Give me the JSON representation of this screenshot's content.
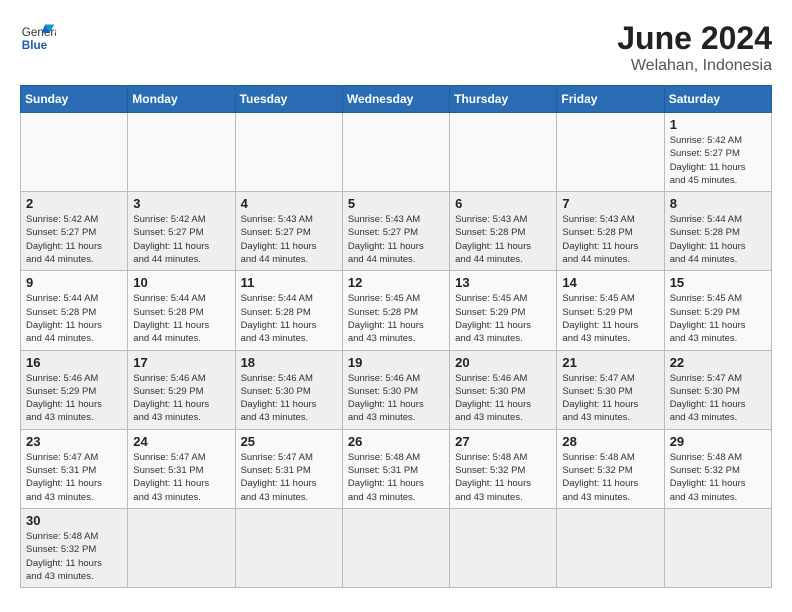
{
  "header": {
    "logo_general": "General",
    "logo_blue": "Blue",
    "month_title": "June 2024",
    "subtitle": "Welahan, Indonesia"
  },
  "days_of_week": [
    "Sunday",
    "Monday",
    "Tuesday",
    "Wednesday",
    "Thursday",
    "Friday",
    "Saturday"
  ],
  "weeks": [
    [
      {
        "day": "",
        "info": ""
      },
      {
        "day": "",
        "info": ""
      },
      {
        "day": "",
        "info": ""
      },
      {
        "day": "",
        "info": ""
      },
      {
        "day": "",
        "info": ""
      },
      {
        "day": "",
        "info": ""
      },
      {
        "day": "1",
        "info": "Sunrise: 5:42 AM\nSunset: 5:27 PM\nDaylight: 11 hours\nand 45 minutes."
      }
    ],
    [
      {
        "day": "2",
        "info": "Sunrise: 5:42 AM\nSunset: 5:27 PM\nDaylight: 11 hours\nand 44 minutes."
      },
      {
        "day": "3",
        "info": "Sunrise: 5:42 AM\nSunset: 5:27 PM\nDaylight: 11 hours\nand 44 minutes."
      },
      {
        "day": "4",
        "info": "Sunrise: 5:43 AM\nSunset: 5:27 PM\nDaylight: 11 hours\nand 44 minutes."
      },
      {
        "day": "5",
        "info": "Sunrise: 5:43 AM\nSunset: 5:27 PM\nDaylight: 11 hours\nand 44 minutes."
      },
      {
        "day": "6",
        "info": "Sunrise: 5:43 AM\nSunset: 5:28 PM\nDaylight: 11 hours\nand 44 minutes."
      },
      {
        "day": "7",
        "info": "Sunrise: 5:43 AM\nSunset: 5:28 PM\nDaylight: 11 hours\nand 44 minutes."
      },
      {
        "day": "8",
        "info": "Sunrise: 5:44 AM\nSunset: 5:28 PM\nDaylight: 11 hours\nand 44 minutes."
      }
    ],
    [
      {
        "day": "9",
        "info": "Sunrise: 5:44 AM\nSunset: 5:28 PM\nDaylight: 11 hours\nand 44 minutes."
      },
      {
        "day": "10",
        "info": "Sunrise: 5:44 AM\nSunset: 5:28 PM\nDaylight: 11 hours\nand 44 minutes."
      },
      {
        "day": "11",
        "info": "Sunrise: 5:44 AM\nSunset: 5:28 PM\nDaylight: 11 hours\nand 43 minutes."
      },
      {
        "day": "12",
        "info": "Sunrise: 5:45 AM\nSunset: 5:28 PM\nDaylight: 11 hours\nand 43 minutes."
      },
      {
        "day": "13",
        "info": "Sunrise: 5:45 AM\nSunset: 5:29 PM\nDaylight: 11 hours\nand 43 minutes."
      },
      {
        "day": "14",
        "info": "Sunrise: 5:45 AM\nSunset: 5:29 PM\nDaylight: 11 hours\nand 43 minutes."
      },
      {
        "day": "15",
        "info": "Sunrise: 5:45 AM\nSunset: 5:29 PM\nDaylight: 11 hours\nand 43 minutes."
      }
    ],
    [
      {
        "day": "16",
        "info": "Sunrise: 5:46 AM\nSunset: 5:29 PM\nDaylight: 11 hours\nand 43 minutes."
      },
      {
        "day": "17",
        "info": "Sunrise: 5:46 AM\nSunset: 5:29 PM\nDaylight: 11 hours\nand 43 minutes."
      },
      {
        "day": "18",
        "info": "Sunrise: 5:46 AM\nSunset: 5:30 PM\nDaylight: 11 hours\nand 43 minutes."
      },
      {
        "day": "19",
        "info": "Sunrise: 5:46 AM\nSunset: 5:30 PM\nDaylight: 11 hours\nand 43 minutes."
      },
      {
        "day": "20",
        "info": "Sunrise: 5:46 AM\nSunset: 5:30 PM\nDaylight: 11 hours\nand 43 minutes."
      },
      {
        "day": "21",
        "info": "Sunrise: 5:47 AM\nSunset: 5:30 PM\nDaylight: 11 hours\nand 43 minutes."
      },
      {
        "day": "22",
        "info": "Sunrise: 5:47 AM\nSunset: 5:30 PM\nDaylight: 11 hours\nand 43 minutes."
      }
    ],
    [
      {
        "day": "23",
        "info": "Sunrise: 5:47 AM\nSunset: 5:31 PM\nDaylight: 11 hours\nand 43 minutes."
      },
      {
        "day": "24",
        "info": "Sunrise: 5:47 AM\nSunset: 5:31 PM\nDaylight: 11 hours\nand 43 minutes."
      },
      {
        "day": "25",
        "info": "Sunrise: 5:47 AM\nSunset: 5:31 PM\nDaylight: 11 hours\nand 43 minutes."
      },
      {
        "day": "26",
        "info": "Sunrise: 5:48 AM\nSunset: 5:31 PM\nDaylight: 11 hours\nand 43 minutes."
      },
      {
        "day": "27",
        "info": "Sunrise: 5:48 AM\nSunset: 5:32 PM\nDaylight: 11 hours\nand 43 minutes."
      },
      {
        "day": "28",
        "info": "Sunrise: 5:48 AM\nSunset: 5:32 PM\nDaylight: 11 hours\nand 43 minutes."
      },
      {
        "day": "29",
        "info": "Sunrise: 5:48 AM\nSunset: 5:32 PM\nDaylight: 11 hours\nand 43 minutes."
      }
    ],
    [
      {
        "day": "30",
        "info": "Sunrise: 5:48 AM\nSunset: 5:32 PM\nDaylight: 11 hours\nand 43 minutes."
      },
      {
        "day": "",
        "info": ""
      },
      {
        "day": "",
        "info": ""
      },
      {
        "day": "",
        "info": ""
      },
      {
        "day": "",
        "info": ""
      },
      {
        "day": "",
        "info": ""
      },
      {
        "day": "",
        "info": ""
      }
    ]
  ]
}
